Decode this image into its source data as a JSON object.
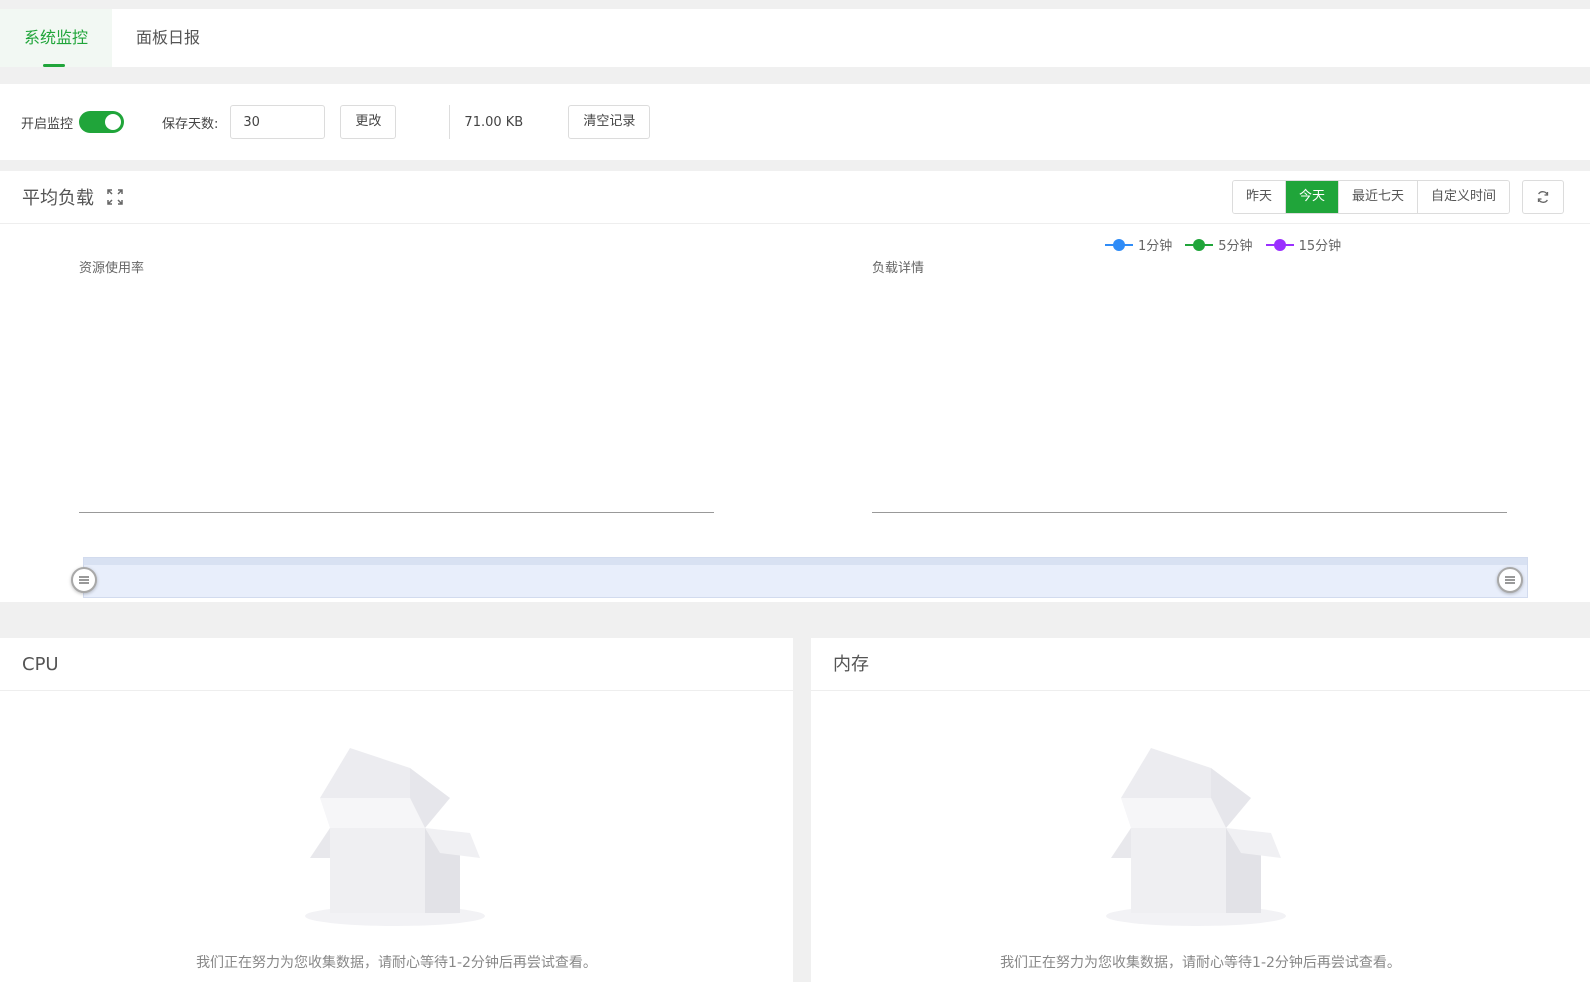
{
  "tabs": [
    {
      "label": "系统监控",
      "active": true
    },
    {
      "label": "面板日报",
      "active": false
    }
  ],
  "toolbar": {
    "monitor_label": "开启监控",
    "monitor_enabled": true,
    "days_label": "保存天数:",
    "days_value": "30",
    "change_label": "更改",
    "size_text": "71.00 KB",
    "clear_label": "清空记录"
  },
  "load": {
    "title": "平均负载",
    "ranges": [
      {
        "label": "昨天",
        "active": false
      },
      {
        "label": "今天",
        "active": true
      },
      {
        "label": "最近七天",
        "active": false
      },
      {
        "label": "自定义时间",
        "active": false
      }
    ],
    "left_chart_title": "资源使用率",
    "right_chart_title": "负载详情",
    "legend": [
      {
        "label": "1分钟",
        "color": "#2f8cf7"
      },
      {
        "label": "5分钟",
        "color": "#20a53a"
      },
      {
        "label": "15分钟",
        "color": "#9b30ff"
      }
    ]
  },
  "cpu": {
    "title": "CPU",
    "empty_text": "我们正在努力为您收集数据，请耐心等待1-2分钟后再尝试查看。"
  },
  "memory": {
    "title": "内存",
    "empty_text": "我们正在努力为您收集数据，请耐心等待1-2分钟后再尝试查看。"
  },
  "colors": {
    "accent": "#20a53a",
    "zoom_fill": "#e8eefb"
  }
}
